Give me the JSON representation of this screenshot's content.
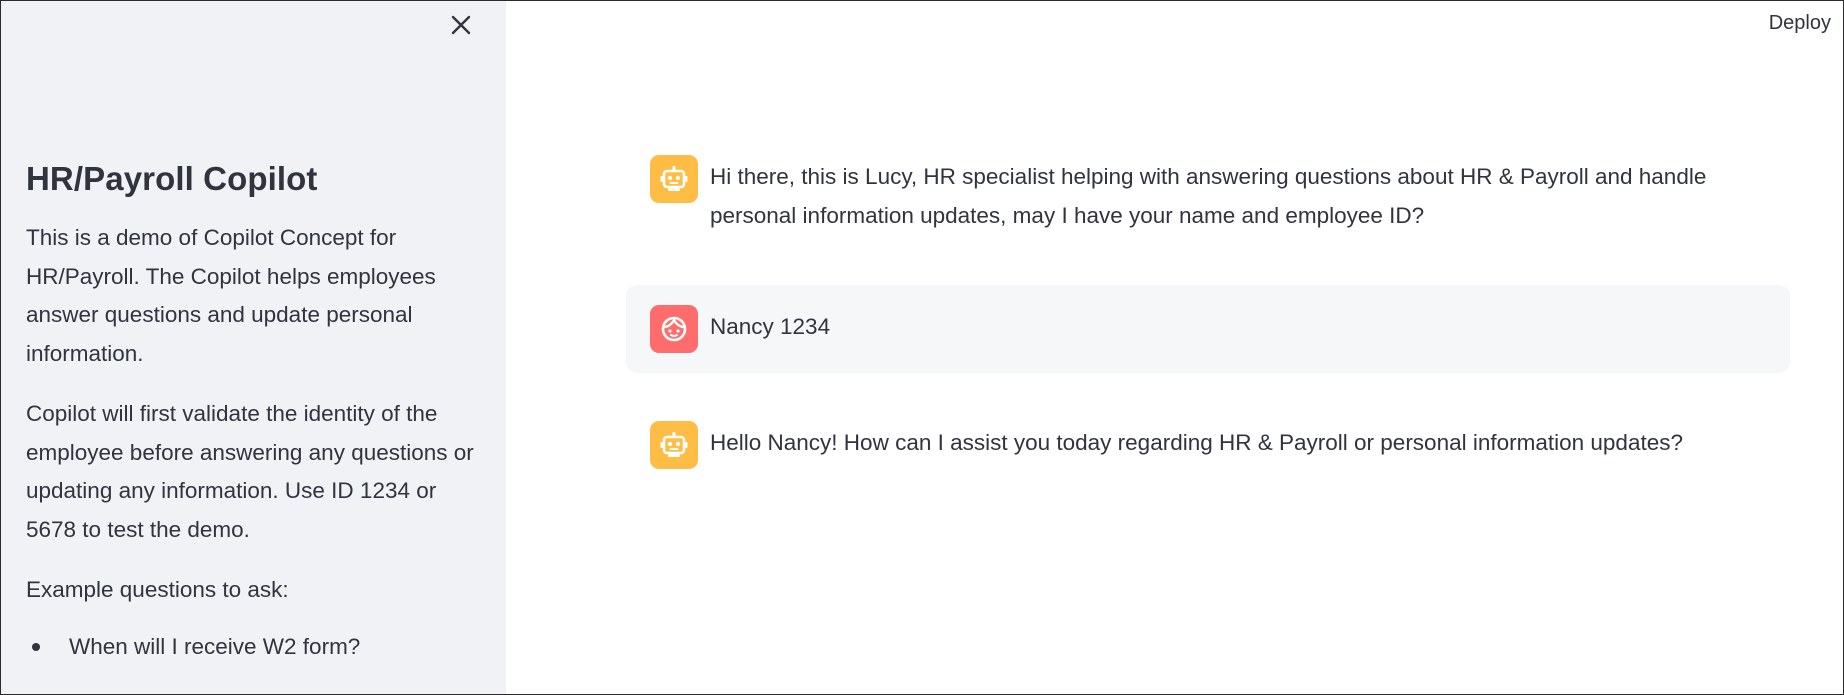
{
  "header": {
    "deploy_label": "Deploy"
  },
  "sidebar": {
    "close_icon": "close-icon",
    "title": "HR/Payroll Copilot",
    "paragraphs": [
      "This is a demo of Copilot Concept for HR/Payroll. The Copilot helps employees answer questions and update personal information.",
      "Copilot will first validate the identity of the employee before answering any questions or updating any information. Use ID 1234 or 5678 to test the demo.",
      "Example questions to ask:"
    ],
    "examples": [
      "When will I receive W2 form?"
    ]
  },
  "chat": {
    "messages": [
      {
        "role": "assistant",
        "avatar_icon": "robot-icon",
        "text": "Hi there, this is Lucy, HR specialist helping with answering questions about HR & Payroll and handle personal information updates, may I have your name and employee ID?"
      },
      {
        "role": "user",
        "avatar_icon": "user-face-icon",
        "text": "Nancy 1234"
      },
      {
        "role": "assistant",
        "avatar_icon": "robot-icon",
        "text": "Hello Nancy! How can I assist you today regarding HR & Payroll or personal information updates?"
      }
    ]
  },
  "colors": {
    "sidebar_bg": "#f0f2f6",
    "assistant_avatar": "#ffbd45",
    "user_avatar": "#ff6c6c",
    "user_message_bg": "#f6f7f9",
    "text": "#31333f"
  }
}
